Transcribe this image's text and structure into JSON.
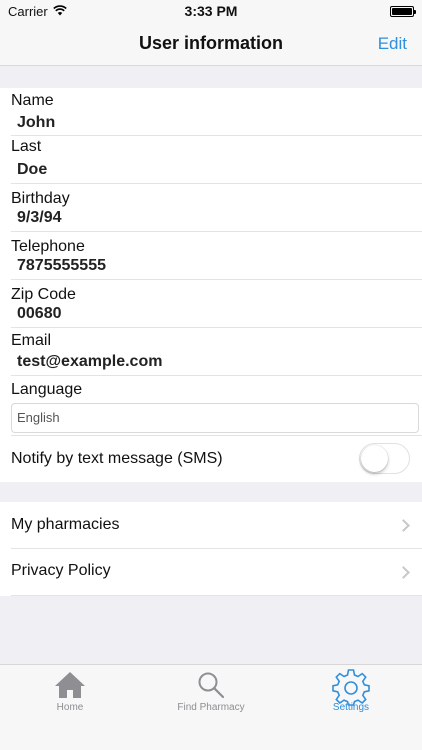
{
  "status_bar": {
    "carrier": "Carrier",
    "time": "3:33 PM"
  },
  "nav": {
    "title": "User information",
    "edit_label": "Edit"
  },
  "profile": {
    "fields": [
      {
        "label": "Name",
        "value": "John"
      },
      {
        "label": "Last",
        "value": "Doe"
      },
      {
        "label": "Birthday",
        "value": "9/3/94"
      },
      {
        "label": "Telephone",
        "value": "7875555555"
      },
      {
        "label": "Zip Code",
        "value": "00680"
      },
      {
        "label": "Email",
        "value": "test@example.com"
      }
    ],
    "language": {
      "label": "Language",
      "selected": "English"
    },
    "sms": {
      "label": "Notify by text message (SMS)",
      "enabled": false
    }
  },
  "links": [
    {
      "label": "My pharmacies"
    },
    {
      "label": "Privacy Policy"
    }
  ],
  "tabs": [
    {
      "label": "Home",
      "icon": "home-icon",
      "active": false
    },
    {
      "label": "Find Pharmacy",
      "icon": "search-icon",
      "active": false
    },
    {
      "label": "Settings",
      "icon": "gear-icon",
      "active": true
    }
  ],
  "colors": {
    "accent": "#2f8fdc",
    "inactive_tab": "#8e8e93",
    "background": "#efeff4"
  }
}
